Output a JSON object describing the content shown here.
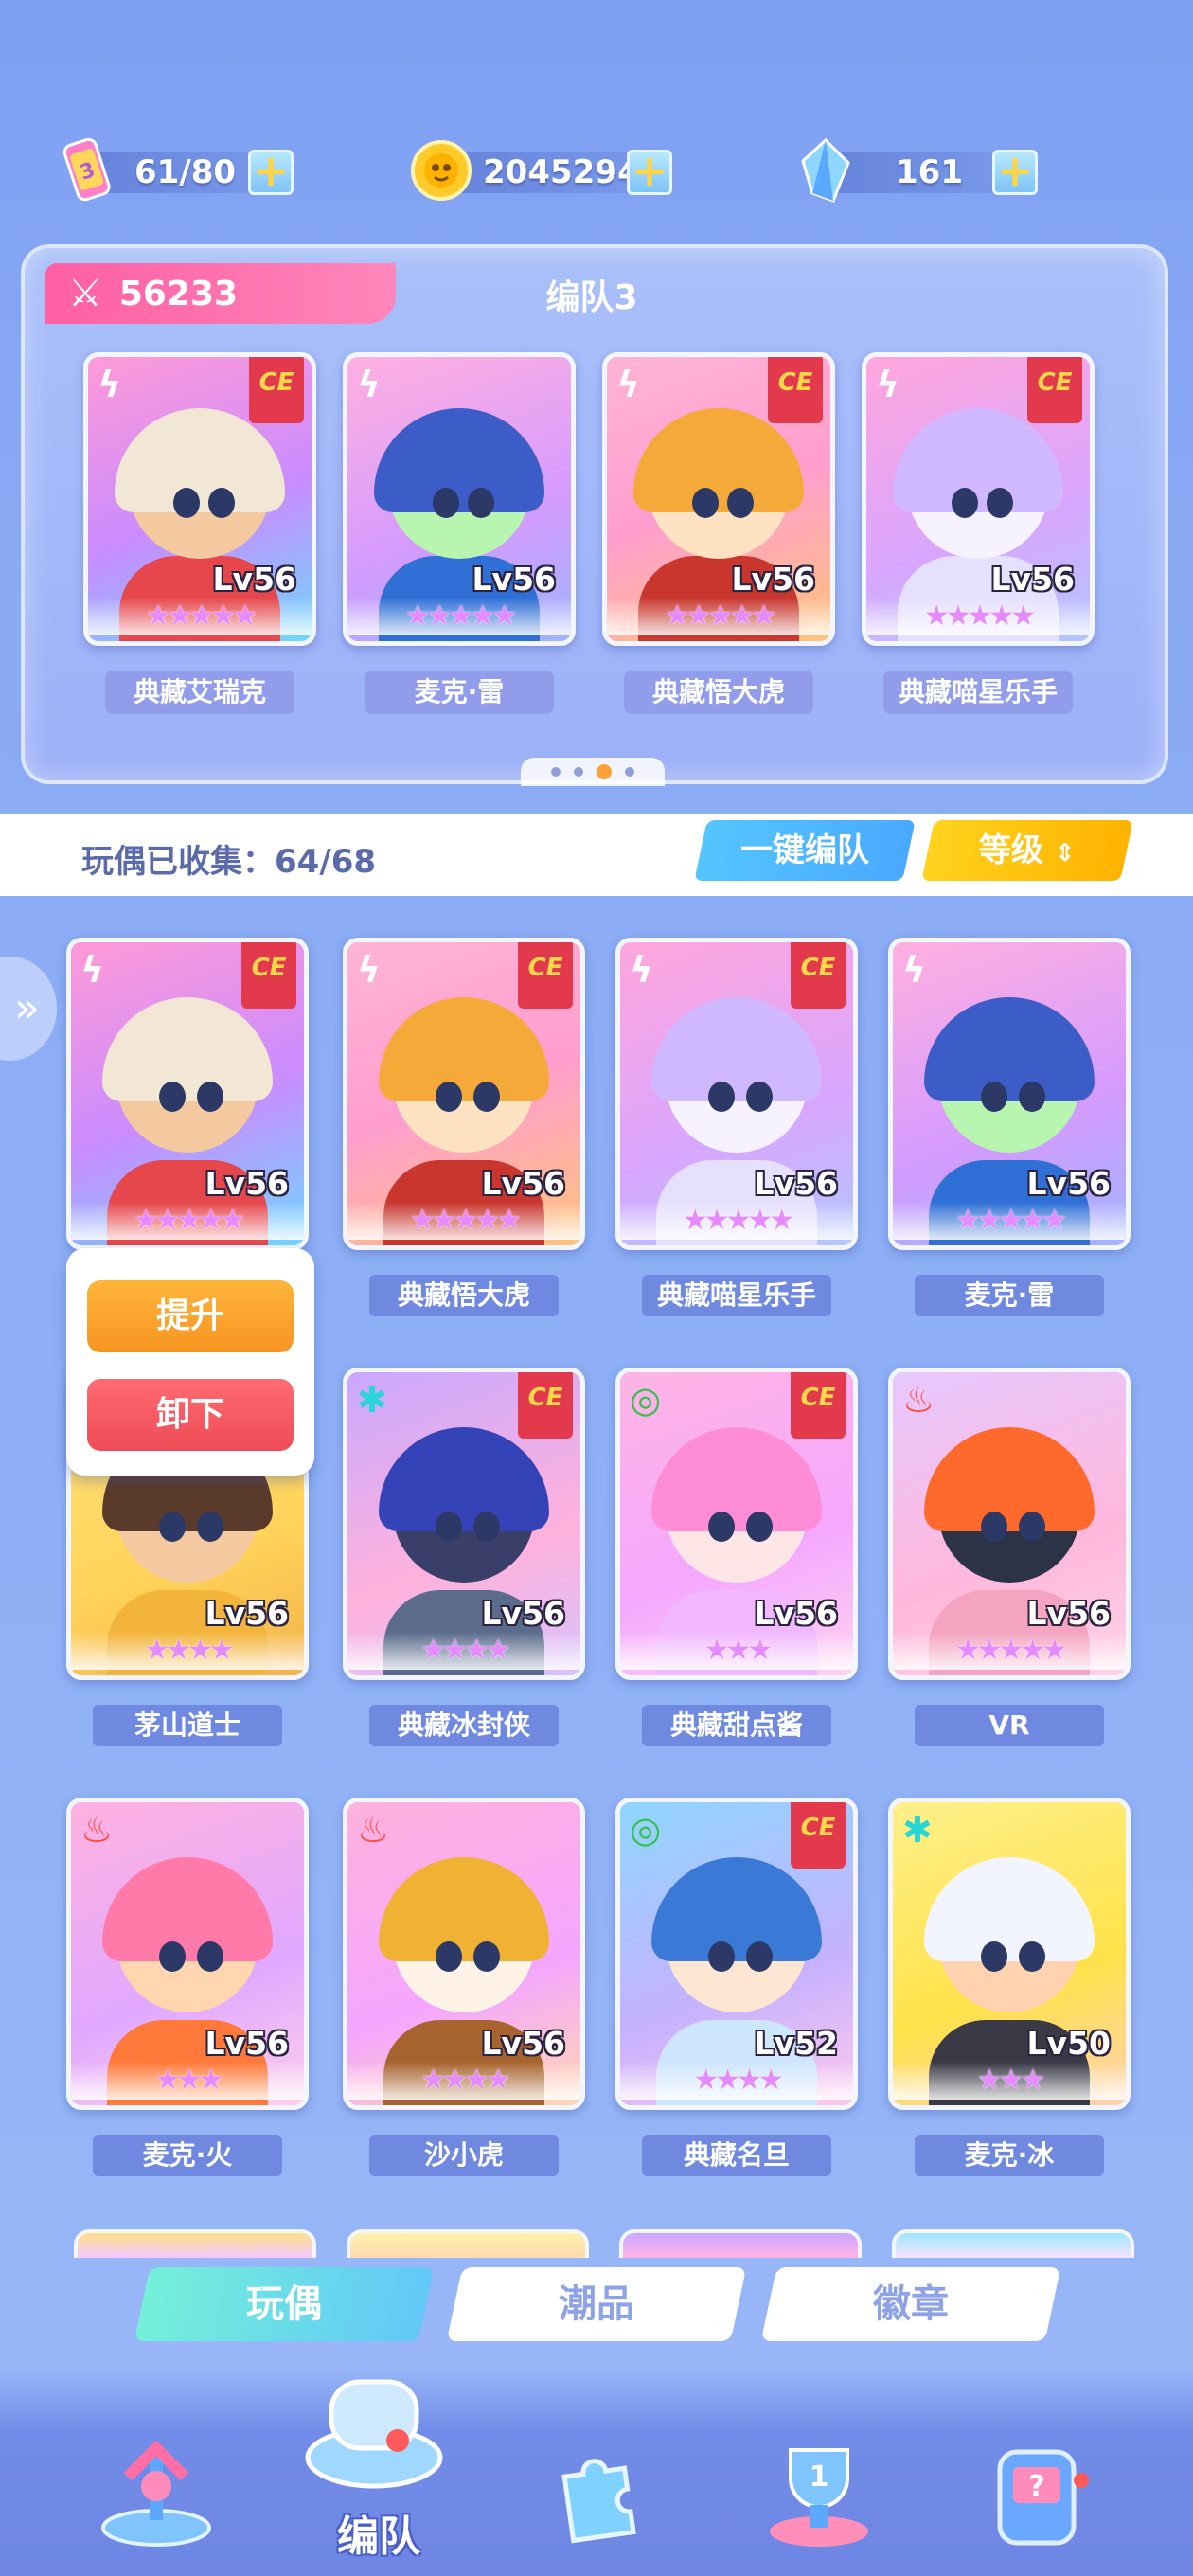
{
  "resources": [
    {
      "icon": "energy-ticket-icon",
      "value": "61/80"
    },
    {
      "icon": "gold-coin-icon",
      "value": "2045294"
    },
    {
      "icon": "crystal-icon",
      "value": "161"
    }
  ],
  "team": {
    "power": "56233",
    "title": "编队3",
    "members": [
      {
        "name": "典藏艾瑞克",
        "level": "Lv56",
        "stars": "★★★★★",
        "element": "ϟ",
        "element_color": "#ffffff",
        "ce": true,
        "theme": "skull"
      },
      {
        "name": "麦克·雷",
        "level": "Lv56",
        "stars": "★★★★★",
        "element": "ϟ",
        "element_color": "#ffffff",
        "ce": false,
        "theme": "helmet-blue"
      },
      {
        "name": "典藏悟大虎",
        "level": "Lv56",
        "stars": "★★★★★",
        "element": "ϟ",
        "element_color": "#ffffff",
        "ce": true,
        "theme": "tiger-gold"
      },
      {
        "name": "典藏喵星乐手",
        "level": "Lv56",
        "stars": "★★★★★",
        "element": "ϟ",
        "element_color": "#ffffff",
        "ce": true,
        "theme": "cat-dj"
      }
    ],
    "page_count": 4,
    "active_page": 3
  },
  "collection": {
    "label": "玩偶已收集：64/68",
    "auto_team_button": "一键编队",
    "sort_button": "等级"
  },
  "popup": {
    "upgrade_label": "提升",
    "remove_label": "卸下"
  },
  "cards": [
    {
      "name": "",
      "level": "Lv56",
      "stars": "★★★★★",
      "element": "ϟ",
      "element_color": "#ffffff",
      "ce": true,
      "theme": "skull"
    },
    {
      "name": "典藏悟大虎",
      "level": "Lv56",
      "stars": "★★★★★",
      "element": "ϟ",
      "element_color": "#ffffff",
      "ce": true,
      "theme": "tiger-gold"
    },
    {
      "name": "典藏喵星乐手",
      "level": "Lv56",
      "stars": "★★★★★",
      "element": "ϟ",
      "element_color": "#ffffff",
      "ce": true,
      "theme": "cat-dj"
    },
    {
      "name": "麦克·雷",
      "level": "Lv56",
      "stars": "★★★★★",
      "element": "ϟ",
      "element_color": "#ffffff",
      "ce": false,
      "theme": "helmet-blue"
    },
    {
      "name": "茅山道士",
      "level": "Lv56",
      "stars": "★★★★",
      "element": "",
      "element_color": "#ffffff",
      "ce": false,
      "theme": "taoist"
    },
    {
      "name": "典藏冰封侠",
      "level": "Lv56",
      "stars": "★★★★",
      "element": "✱",
      "element_color": "#27d6d6",
      "ce": true,
      "theme": "ice-knight"
    },
    {
      "name": "典藏甜点酱",
      "level": "Lv56",
      "stars": "★★★",
      "element": "◎",
      "element_color": "#33c24a",
      "ce": true,
      "theme": "sweet-girl"
    },
    {
      "name": "VR",
      "level": "Lv56",
      "stars": "★★★★★",
      "element": "♨",
      "element_color": "#ff4a3a",
      "ce": false,
      "theme": "vr-robot"
    },
    {
      "name": "麦克·火",
      "level": "Lv56",
      "stars": "★★★",
      "element": "♨",
      "element_color": "#ff4a3a",
      "ce": false,
      "theme": "helmet-pink"
    },
    {
      "name": "沙小虎",
      "level": "Lv56",
      "stars": "★★★★",
      "element": "♨",
      "element_color": "#ff4a3a",
      "ce": false,
      "theme": "tiger-monk"
    },
    {
      "name": "典藏名旦",
      "level": "Lv52",
      "stars": "★★★★",
      "element": "◎",
      "element_color": "#33c24a",
      "ce": true,
      "theme": "opera"
    },
    {
      "name": "麦克·冰",
      "level": "Lv50",
      "stars": "★★★",
      "element": "✱",
      "element_color": "#27d6d6",
      "ce": false,
      "theme": "helmet-white"
    }
  ],
  "tabs": [
    "玩偶",
    "潮品",
    "徽章"
  ],
  "active_tab": 0,
  "nav": {
    "items": [
      "summon-icon",
      "team-whistle-icon",
      "puzzle-icon",
      "trophy-icon",
      "slot-machine-icon"
    ],
    "active_label": "编队"
  },
  "ce_badge": "CE",
  "colors": {
    "power_tag": "#ff5fa3",
    "auto_team": "#49a9ff",
    "sort": "#ffb300",
    "upgrade": "#f79422",
    "remove": "#ee4c57",
    "tab_active": "#74f0d9"
  }
}
